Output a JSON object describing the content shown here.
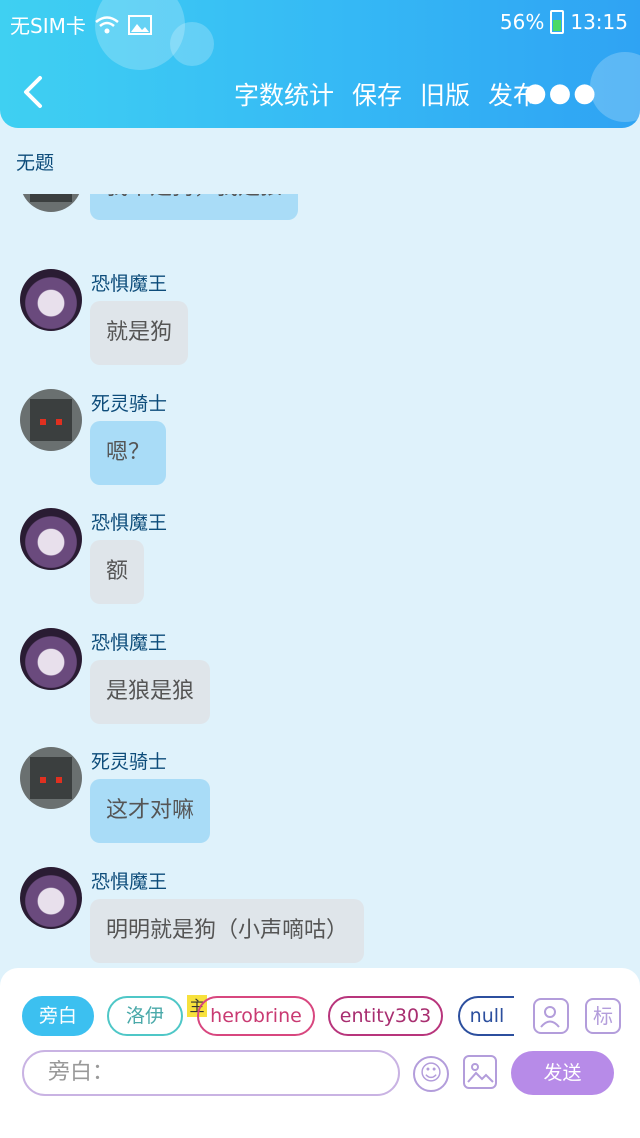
{
  "status_bar": {
    "carrier": "无SIM卡",
    "battery": "56%",
    "time": "13:15"
  },
  "toolbar": {
    "actions": [
      "字数统计",
      "保存",
      "旧版",
      "发布"
    ]
  },
  "document": {
    "title": "无题"
  },
  "messages": [
    {
      "name": "",
      "text": "我不是狗，我是狼",
      "style": "blue"
    },
    {
      "name": "恐惧魔王",
      "text": "就是狗",
      "style": "grey"
    },
    {
      "name": "死灵骑士",
      "text": "嗯？",
      "style": "blue"
    },
    {
      "name": "恐惧魔王",
      "text": "额",
      "style": "grey"
    },
    {
      "name": "恐惧魔王",
      "text": "是狼是狼",
      "style": "grey"
    },
    {
      "name": "死灵骑士",
      "text": "这才对嘛",
      "style": "blue"
    },
    {
      "name": "恐惧魔王",
      "text": "明明就是狗（小声嘀咕）",
      "style": "grey"
    }
  ],
  "roles": [
    "旁白",
    "洛伊",
    "herobrine",
    "entity303",
    "null"
  ],
  "main_tag": "主",
  "tool_icons": {
    "marker": "标"
  },
  "composer": {
    "placeholder": "旁白：",
    "send_label": "发送"
  }
}
